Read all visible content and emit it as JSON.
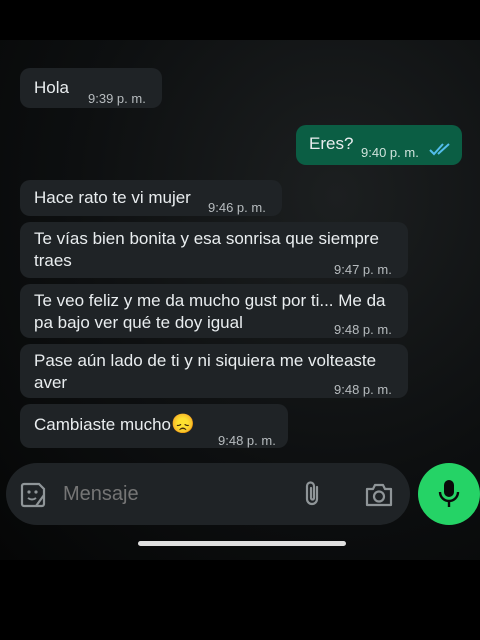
{
  "messages": [
    {
      "direction": "in",
      "text": "Hola",
      "time": "9:39 p. m."
    },
    {
      "direction": "out",
      "text": "Eres?",
      "time": "9:40 p. m.",
      "status": "read"
    },
    {
      "direction": "in",
      "text": "Hace rato te vi mujer",
      "time": "9:46 p. m."
    },
    {
      "direction": "in",
      "text": "Te vías bien bonita y esa sonrisa que siempre traes",
      "time": "9:47 p. m."
    },
    {
      "direction": "in",
      "text": "Te veo feliz y me da mucho gust por ti... Me da pa bajo ver qué te doy igual",
      "time": "9:48 p. m."
    },
    {
      "direction": "in",
      "text": "Pase aún lado de ti y ni siquiera me volteaste aver",
      "time": "9:48 p. m."
    },
    {
      "direction": "in",
      "text": "Cambiaste mucho",
      "emoji": "😞",
      "time": "9:48 p. m."
    }
  ],
  "composer": {
    "placeholder": "Mensaje",
    "icons": [
      "sticker-icon",
      "attach-icon",
      "camera-icon",
      "mic-icon"
    ]
  },
  "colors": {
    "incoming_bubble": "#1f2326",
    "outgoing_bubble": "#0b5e44",
    "accent": "#25d366",
    "read_ticks": "#53bdeb"
  }
}
